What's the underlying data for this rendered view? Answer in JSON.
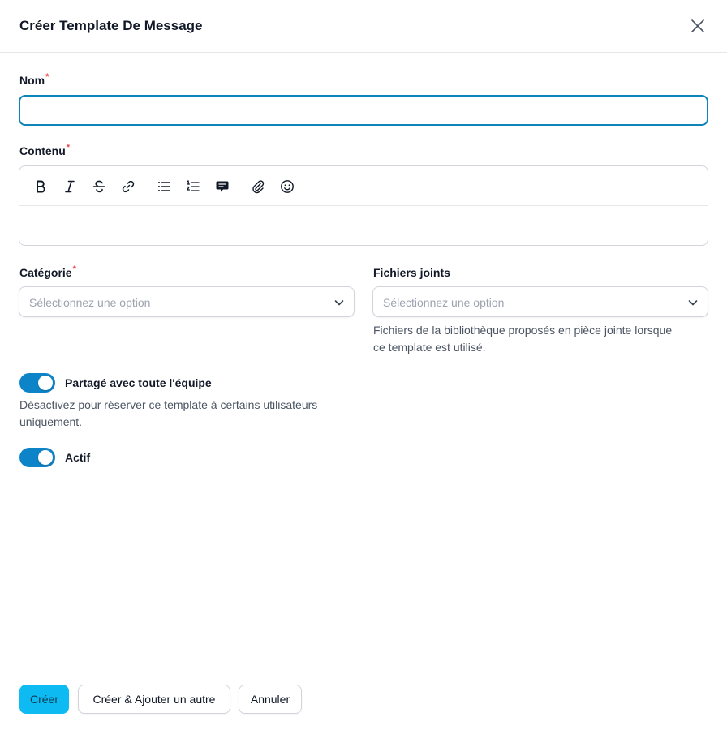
{
  "modal": {
    "title": "Créer Template De Message",
    "close_icon": "close-icon"
  },
  "fields": {
    "nom": {
      "label": "Nom",
      "required_mark": "*",
      "value": "",
      "placeholder": ""
    },
    "contenu": {
      "label": "Contenu",
      "required_mark": "*",
      "toolbar": [
        "bold-icon",
        "italic-icon",
        "strikethrough-icon",
        "link-icon",
        "bullet-list-icon",
        "numbered-list-icon",
        "comment-icon",
        "attachment-icon",
        "emoji-icon"
      ]
    },
    "categorie": {
      "label": "Catégorie",
      "required_mark": "*",
      "placeholder": "Sélectionnez une option"
    },
    "fichiers_joints": {
      "label": "Fichiers joints",
      "placeholder": "Sélectionnez une option",
      "help_line1": "Fichiers de la bibliothèque proposés en pièce jointe lorsque",
      "help_line2": "ce template est utilisé."
    },
    "partage": {
      "label": "Partagé avec toute l'équipe",
      "enabled": true,
      "help_line1": "Désactivez pour réserver ce template à certains utilisateurs",
      "help_line2": "uniquement."
    },
    "actif": {
      "label": "Actif",
      "enabled": true
    }
  },
  "footer": {
    "create_label": "Créer",
    "create_add_label": "Créer & Ajouter un autre",
    "cancel_label": "Annuler"
  },
  "colors": {
    "accent": "#0e84c8",
    "primary_button": "#0ebaf2",
    "required": "#ef4444"
  }
}
